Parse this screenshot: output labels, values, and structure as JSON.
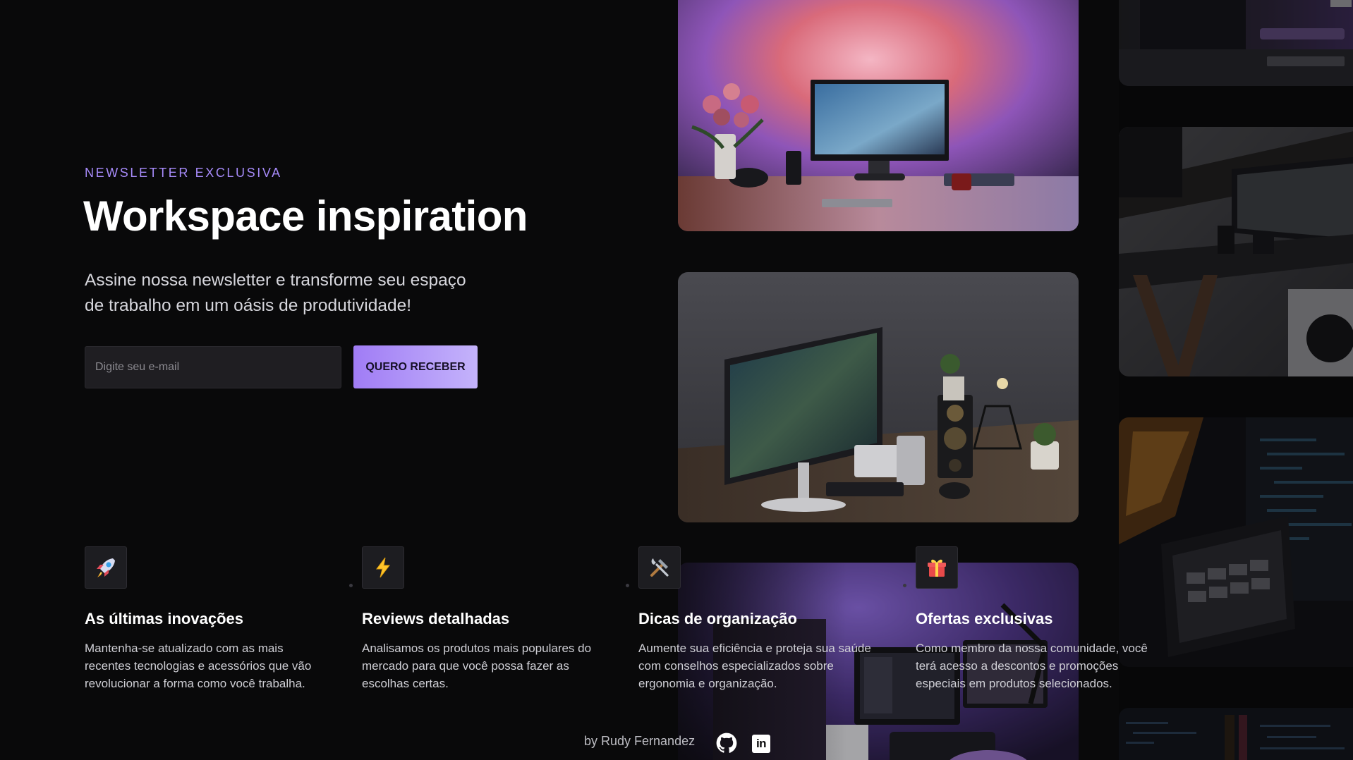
{
  "hero": {
    "eyebrow": "NEWSLETTER EXCLUSIVA",
    "title": "Workspace inspiration",
    "lede_line_1": "Assine nossa newsletter e transforme seu espaço",
    "lede_line_2": "de trabalho em um oásis de produtividade!"
  },
  "form": {
    "email_placeholder": "Digite seu e-mail",
    "email_value": "",
    "submit_label": "QUERO RECEBER"
  },
  "features": [
    {
      "icon": "rocket-icon",
      "title": "As últimas inovações",
      "lines": [
        "Mantenha-se atualizado com as mais",
        "recentes tecnologias e acessórios que vão",
        "revolucionar a forma como você trabalha."
      ]
    },
    {
      "icon": "lightning-icon",
      "title": "Reviews detalhadas",
      "lines": [
        "Analisamos os produtos mais populares do",
        "mercado para que você possa fazer as",
        "escolhas certas."
      ]
    },
    {
      "icon": "tools-icon",
      "title": "Dicas de organização",
      "lines": [
        "Aumente sua eficiência e proteja sua saúde",
        "com conselhos especializados sobre",
        "ergonomia e organização."
      ]
    },
    {
      "icon": "gift-icon",
      "title": "Ofertas exclusivas",
      "lines": [
        "Como membro da nossa comunidade, você",
        "terá acesso a descontos e promoções",
        "especiais em produtos selecionados."
      ]
    }
  ],
  "footer": {
    "credit": "by Rudy Fernandez",
    "github_icon": "github-icon",
    "linkedin_icon": "linkedin-icon",
    "linkedin_text": "in"
  },
  "gallery": {
    "images": [
      "desk-monitor-photo",
      "desk-speaker-photo",
      "purple-studio-photo",
      "top-desk-photo",
      "dark-desk-photo",
      "laptop-code-photo",
      "code-screen-photo"
    ]
  },
  "colors": {
    "background": "#09090a",
    "accent": "#a78bfa",
    "button_gradient_start": "#a07cf5",
    "button_gradient_end": "#c4b3fb"
  }
}
